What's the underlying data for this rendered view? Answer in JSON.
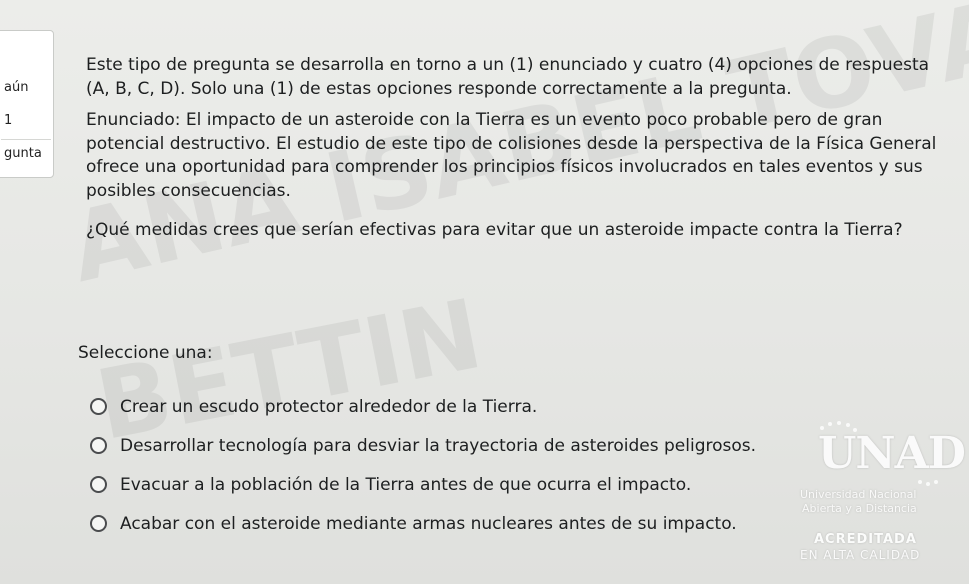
{
  "sidebar": {
    "lines": [
      "aún",
      "1",
      "gunta"
    ]
  },
  "question": {
    "intro": "Este tipo de pregunta se desarrolla en torno a un (1) enunciado y cuatro (4) opciones de respuesta (A, B, C, D). Solo una (1) de estas opciones responde correctamente a la pregunta.",
    "statement": "Enunciado: El impacto de un asteroide con la Tierra es un evento poco probable pero de gran potencial destructivo. El estudio de este tipo de colisiones desde la perspectiva de la Física General ofrece una oportunidad para comprender los principios físicos involucrados en tales eventos y sus posibles consecuencias.",
    "prompt": "¿Qué medidas crees que serían efectivas para evitar que un asteroide impacte contra la Tierra?",
    "select_label": "Seleccione una:",
    "options": [
      "Crear un escudo protector alrededor de la Tierra.",
      "Desarrollar tecnología para desviar la trayectoria de asteroides peligrosos.",
      "Evacuar a la población de la Tierra antes de que ocurra el impacto.",
      "Acabar con el asteroide mediante armas nucleares antes de su impacto."
    ]
  },
  "watermark": {
    "line1": "ANA ISABEL TOVAR",
    "line2": "BETTIN"
  },
  "logo": {
    "main": "UNAD",
    "sub1": "Universidad Nacional",
    "sub2": "Abierta y a Distancia",
    "acc1": "ACREDITADA",
    "acc2": "EN ALTA CALIDAD"
  }
}
